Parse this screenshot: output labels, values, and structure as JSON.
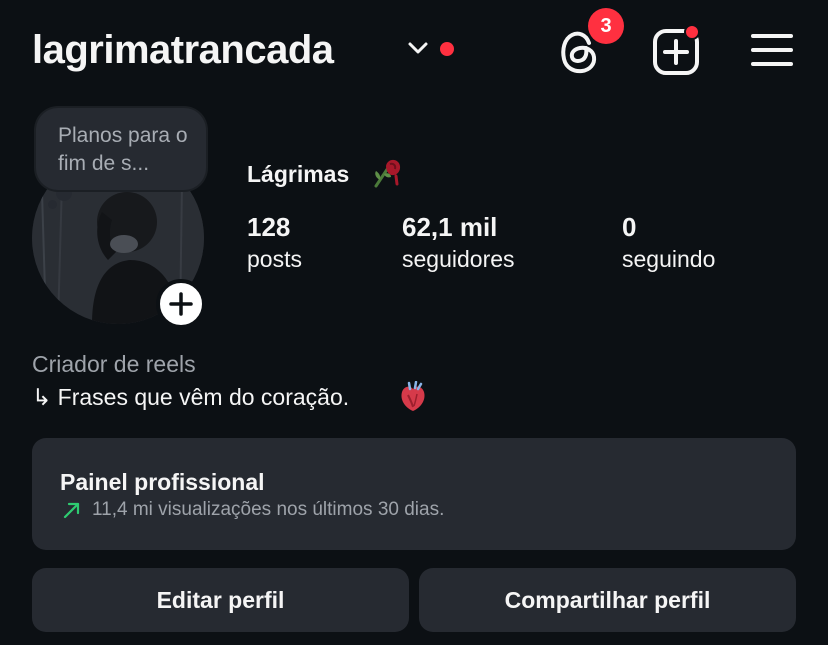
{
  "header": {
    "username": "lagrimatrancada",
    "threads_badge_count": "3",
    "accent_color": "#ff3040"
  },
  "icons": {
    "account_switcher": "chevron-down-icon",
    "threads": "threads-icon",
    "create": "add-square-icon",
    "menu": "hamburger-menu-icon",
    "avatar_add": "plus-icon",
    "trend": "trend-up-arrow-icon",
    "bio_arrow": "return-arrow-icon"
  },
  "note": {
    "text": "Planos para o fim de s..."
  },
  "profile": {
    "display_name": "Lágrimas",
    "name_emoji": "wilted-rose",
    "stats": [
      {
        "value": "128",
        "label": "posts"
      },
      {
        "value": "62,1 mil",
        "label": "seguidores"
      },
      {
        "value": "0",
        "label": "seguindo"
      }
    ],
    "category": "Criador de reels",
    "bio": "↳ Frases que vêm do coração.",
    "bio_emoji": "anatomical-heart"
  },
  "dashboard": {
    "title": "Painel profissional",
    "subtitle": "11,4 mi visualizações nos últimos 30 dias.",
    "trend_color": "#2ecc71"
  },
  "buttons": {
    "edit_profile": "Editar perfil",
    "share_profile": "Compartilhar perfil"
  }
}
